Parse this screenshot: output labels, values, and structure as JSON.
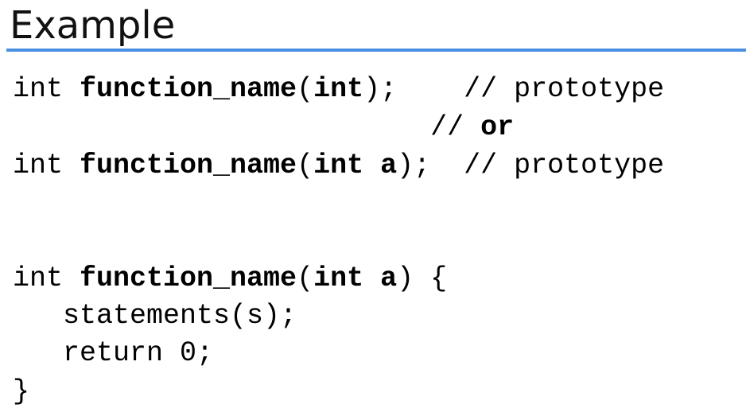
{
  "title": "Example",
  "code": {
    "line1": {
      "type": "int ",
      "name": "function_name",
      "open": "(",
      "param": "int",
      "close": ");",
      "pad": "    ",
      "comment": "// prototype"
    },
    "line2": {
      "pad": "                         ",
      "comment_prefix": "// ",
      "comment_bold": "or"
    },
    "line3": {
      "type": "int ",
      "name": "function_name",
      "open": "(",
      "param": "int a",
      "close": ");",
      "pad": "  ",
      "comment": "// prototype"
    },
    "line4": {
      "type": "int ",
      "name": "function_name",
      "open": "(",
      "param": "int a",
      "close": ") {"
    },
    "line5": "   statements(s);",
    "line6": "   return 0;",
    "line7": "}"
  },
  "colors": {
    "title_rule": "#4a90e2"
  }
}
